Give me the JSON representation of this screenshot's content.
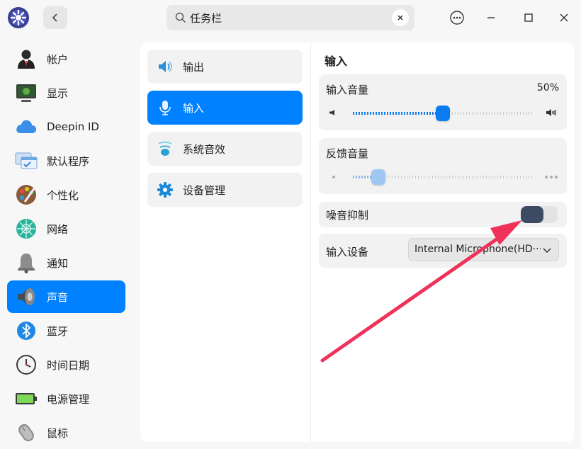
{
  "titlebar": {
    "search_value": "任务栏"
  },
  "sidebar": {
    "items": [
      {
        "label": "帐户",
        "icon": "user-account-icon"
      },
      {
        "label": "显示",
        "icon": "display-monitor-icon"
      },
      {
        "label": "Deepin ID",
        "icon": "cloud-icon"
      },
      {
        "label": "默认程序",
        "icon": "default-apps-icon"
      },
      {
        "label": "个性化",
        "icon": "palette-icon"
      },
      {
        "label": "网络",
        "icon": "network-globe-icon"
      },
      {
        "label": "通知",
        "icon": "bell-icon"
      },
      {
        "label": "声音",
        "icon": "speaker-icon"
      },
      {
        "label": "蓝牙",
        "icon": "bluetooth-icon"
      },
      {
        "label": "时间日期",
        "icon": "clock-icon"
      },
      {
        "label": "电源管理",
        "icon": "battery-icon"
      },
      {
        "label": "鼠标",
        "icon": "mouse-icon"
      }
    ],
    "active_index": 7
  },
  "submenu": {
    "items": [
      {
        "label": "输出",
        "icon": "speaker-output-icon"
      },
      {
        "label": "输入",
        "icon": "microphone-icon"
      },
      {
        "label": "系统音效",
        "icon": "sound-effects-icon"
      },
      {
        "label": "设备管理",
        "icon": "gear-icon"
      }
    ],
    "active_index": 1
  },
  "input_panel": {
    "title": "输入",
    "input_volume": {
      "label": "输入音量",
      "value_text": "50%",
      "level": 0.5
    },
    "feedback_volume": {
      "label": "反馈音量",
      "level": 0.14
    },
    "noise_suppression": {
      "label": "噪音抑制",
      "enabled": false
    },
    "input_device": {
      "label": "输入设备",
      "value": "Internal Microphone(HD···"
    }
  },
  "colors": {
    "accent": "#0081ff",
    "annotation_arrow": "#f0325a"
  }
}
